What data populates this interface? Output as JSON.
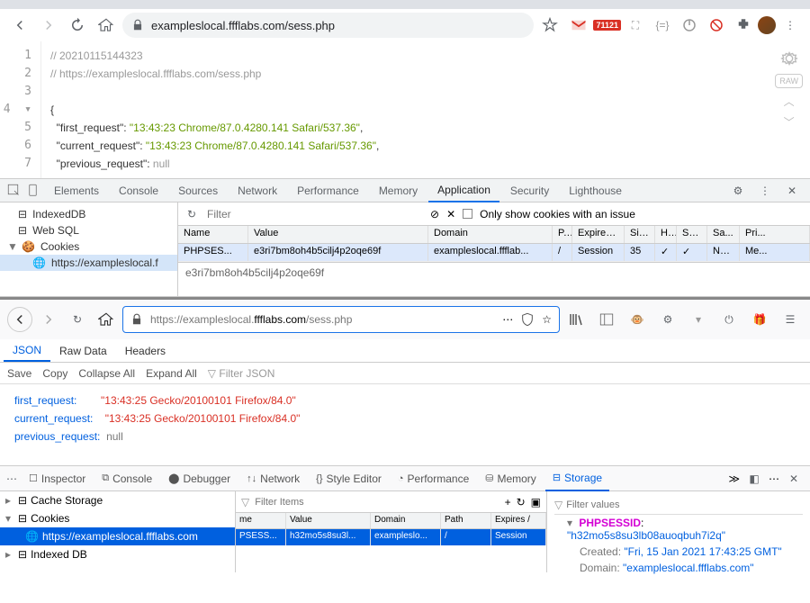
{
  "chrome": {
    "url": "exampleslocal.ffflabs.com/sess.php",
    "badge": "71121",
    "code": {
      "line1": "// 20210115144323",
      "line2": "// https://exampleslocal.ffflabs.com/sess.php",
      "first_key": "\"first_request\"",
      "first_val": "\"13:43:23 Chrome/87.0.4280.141 Safari/537.36\"",
      "current_key": "\"current_request\"",
      "current_val": "\"13:43:23 Chrome/87.0.4280.141 Safari/537.36\"",
      "previous_key": "\"previous_request\"",
      "previous_val": "null",
      "raw": "RAW"
    },
    "devtools": {
      "tabs": {
        "elements": "Elements",
        "console": "Console",
        "sources": "Sources",
        "network": "Network",
        "performance": "Performance",
        "memory": "Memory",
        "application": "Application",
        "security": "Security",
        "lighthouse": "Lighthouse"
      },
      "tree": {
        "indexeddb": "IndexedDB",
        "websql": "Web SQL",
        "cookies": "Cookies",
        "domain": "https://exampleslocal.f"
      },
      "filter_ph": "Filter",
      "only_issue": "Only show cookies with an issue",
      "th": {
        "name": "Name",
        "value": "Value",
        "domain": "Domain",
        "path": "P...",
        "expires": "Expires...",
        "size": "Size",
        "http": "H...",
        "secure": "Sec...",
        "same": "Sa...",
        "pri": "Pri..."
      },
      "row": {
        "name": "PHPSES...",
        "value": "e3ri7bm8oh4b5cilj4p2oqe69f",
        "domain": "exampleslocal.ffflab...",
        "path": "/",
        "expires": "Session",
        "size": "35",
        "http": "✓",
        "secure": "✓",
        "same": "None",
        "pri": "Me..."
      },
      "detail": "e3ri7bm8oh4b5cilj4p2oqe69f"
    }
  },
  "firefox": {
    "url_proto": "https://",
    "url_host": "exampleslocal.",
    "url_dom": "ffflabs.com",
    "url_path": "/sess.php",
    "tabs": {
      "json": "JSON",
      "raw": "Raw Data",
      "headers": "Headers"
    },
    "actions": {
      "save": "Save",
      "copy": "Copy",
      "collapse": "Collapse All",
      "expand": "Expand All",
      "filter": "Filter JSON"
    },
    "json": {
      "first_key": "first_request:",
      "first_val": "\"13:43:25 Gecko/20100101 Firefox/84.0\"",
      "current_key": "current_request:",
      "current_val": "\"13:43:25 Gecko/20100101 Firefox/84.0\"",
      "previous_key": "previous_request:",
      "previous_val": "null"
    },
    "dt": {
      "tabs": {
        "inspector": "Inspector",
        "console": "Console",
        "debugger": "Debugger",
        "network": "Network",
        "style": "Style Editor",
        "performance": "Performance",
        "memory": "Memory",
        "storage": "Storage"
      },
      "tree": {
        "cache": "Cache Storage",
        "cookies": "Cookies",
        "domain": "https://exampleslocal.ffflabs.com",
        "indexed": "Indexed DB"
      },
      "filter_items": "Filter Items",
      "filter_values": "Filter values",
      "th": {
        "name": "me",
        "value": "Value",
        "domain": "Domain",
        "path": "Path",
        "expires": "Expires /"
      },
      "row": {
        "name": "PSESS...",
        "value": "h32mo5s8su3l...",
        "domain": "exampleslo...",
        "path": "/",
        "expires": "Session"
      },
      "side": {
        "key": "PHPSESSID",
        "val": "\"h32mo5s8su3lb08auoqbuh7i2q\"",
        "created_k": "Created:",
        "created_v": "\"Fri, 15 Jan 2021 17:43:25 GMT\"",
        "domain_k": "Domain:",
        "domain_v": "\"exampleslocal.ffflabs.com\""
      }
    }
  }
}
